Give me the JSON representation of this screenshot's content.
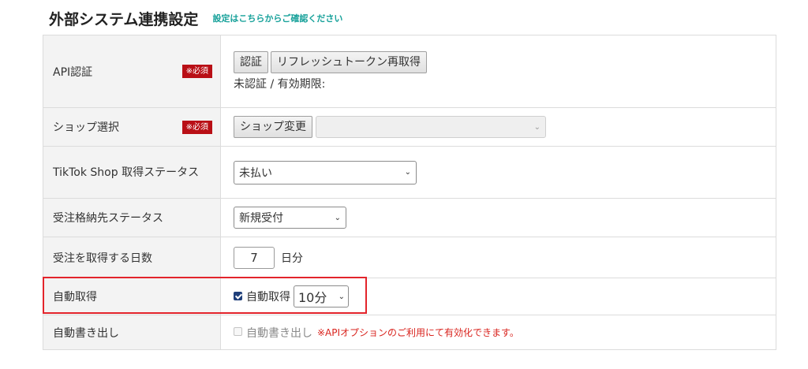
{
  "header": {
    "title": "外部システム連携設定",
    "help_link": "設定はこちらからご確認ください"
  },
  "required_badge": "※必須",
  "rows": {
    "api_auth": {
      "label": "API認証",
      "auth_button": "認証",
      "refresh_button": "リフレッシュトークン再取得",
      "status": "未認証 / 有効期限:"
    },
    "shop": {
      "label": "ショップ選択",
      "change_button": "ショップ変更",
      "select_value": ""
    },
    "fetch_status": {
      "label": "TikTok Shop 取得ステータス",
      "select_value": "未払い"
    },
    "store_status": {
      "label": "受注格納先ステータス",
      "select_value": "新規受付"
    },
    "fetch_days": {
      "label": "受注を取得する日数",
      "value": "7",
      "unit": "日分"
    },
    "auto_fetch": {
      "label": "自動取得",
      "checkbox_label": "自動取得",
      "checked": true,
      "interval_value": "10分"
    },
    "auto_export": {
      "label": "自動書き出し",
      "checkbox_label": "自動書き出し",
      "checked": false,
      "note": "※APIオプションのご利用にて有効化できます。"
    }
  },
  "colors": {
    "required_badge_bg": "#b90f16",
    "link": "#17a19a",
    "note": "#d9231d",
    "highlight_border": "#e3242b",
    "checkbox_checked": "#1f3f7a"
  }
}
